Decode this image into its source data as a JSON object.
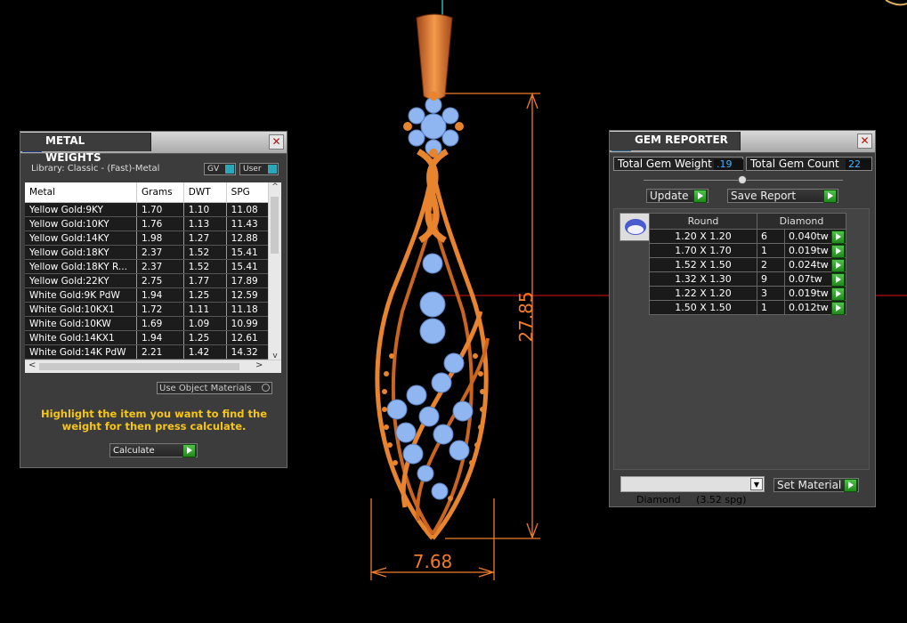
{
  "metal_weights": {
    "title": "METAL WEIGHTS",
    "library": "Library: Classic - (Fast)-Metal",
    "gv_label": "GV",
    "user_label": "User",
    "columns": [
      "Metal",
      "Grams",
      "DWT",
      "SPG"
    ],
    "rows": [
      [
        "Yellow Gold:9KY",
        "1.70",
        "1.10",
        "11.08"
      ],
      [
        "Yellow Gold:10KY",
        "1.76",
        "1.13",
        "11.43"
      ],
      [
        "Yellow Gold:14KY",
        "1.98",
        "1.27",
        "12.88"
      ],
      [
        "Yellow Gold:18KY",
        "2.37",
        "1.52",
        "15.41"
      ],
      [
        "Yellow Gold:18KY R...",
        "2.37",
        "1.52",
        "15.41"
      ],
      [
        "Yellow Gold:22KY",
        "2.75",
        "1.77",
        "17.89"
      ],
      [
        "White Gold:9K PdW",
        "1.94",
        "1.25",
        "12.59"
      ],
      [
        "White Gold:10KX1",
        "1.72",
        "1.11",
        "11.18"
      ],
      [
        "White Gold:10KW",
        "1.69",
        "1.09",
        "10.99"
      ],
      [
        "White Gold:14KX1",
        "1.94",
        "1.25",
        "12.61"
      ],
      [
        "White Gold:14K PdW",
        "2.21",
        "1.42",
        "14.32"
      ]
    ],
    "use_object_materials": "Use Object Materials",
    "hint": "Highlight the item you want to find the weight for then press calculate.",
    "calculate": "Calculate",
    "scroll_up": "^",
    "scroll_down": "v",
    "scroll_left": "<",
    "scroll_right": ">"
  },
  "gem_reporter": {
    "title": "GEM REPORTER",
    "total_weight_label": "Total Gem Weight",
    "total_weight_value": ".19",
    "total_count_label": "Total Gem Count",
    "total_count_value": "22",
    "update": "Update",
    "save_report": "Save Report",
    "columns": [
      "Round",
      "Diamond"
    ],
    "rows": [
      [
        "1.20 X 1.20",
        "6",
        "0.040tw"
      ],
      [
        "1.70 X 1.70",
        "1",
        "0.019tw"
      ],
      [
        "1.52 X 1.50",
        "2",
        "0.024tw"
      ],
      [
        "1.32 X 1.30",
        "9",
        "0.07tw"
      ],
      [
        "1.22 X 1.20",
        "3",
        "0.019tw"
      ],
      [
        "1.50 X 1.50",
        "1",
        "0.012tw"
      ]
    ],
    "material_select": "Diamond     (3.52 spg)",
    "set_material": "Set Material"
  },
  "dimensions": {
    "height": "27.85",
    "width": "7.68"
  },
  "colors": {
    "metal_orange": "#e8832e",
    "gem_blue": "#8fb6f0",
    "dimension_orange": "#f07c2a",
    "hint_yellow": "#f5c518"
  }
}
